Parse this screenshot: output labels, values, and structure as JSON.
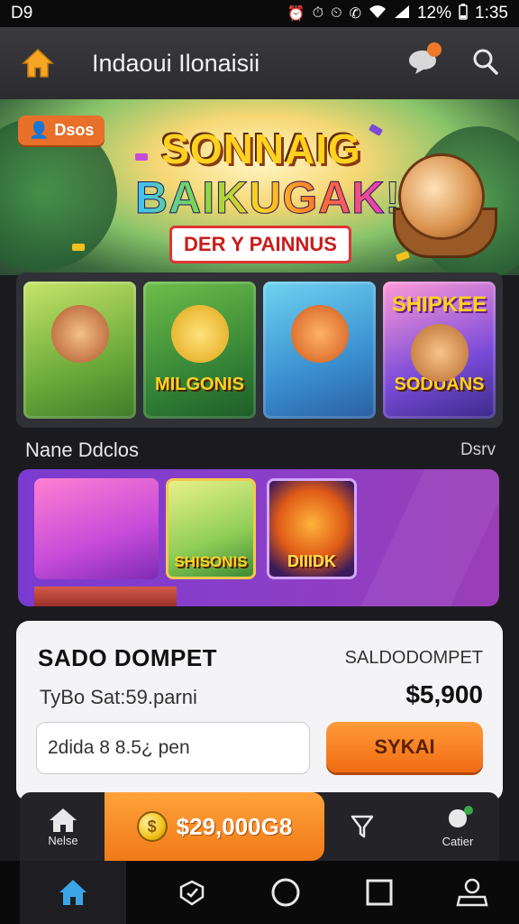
{
  "status_bar": {
    "left": "D9",
    "battery": "12%",
    "time": "1:35"
  },
  "app_bar": {
    "title": "Indaoui Ilonaisii"
  },
  "banner": {
    "users_badge": "Dsos",
    "title_line1": "SONNAIG",
    "title_line2": "BAIKUGAK!",
    "ribbon": "DER Y PAINNUS"
  },
  "game_grid": {
    "tiles": [
      {
        "label": ""
      },
      {
        "label": "MILGONIS"
      },
      {
        "label": ""
      },
      {
        "label_top": "SHIPKEE",
        "label": "SODUANS"
      }
    ]
  },
  "section": {
    "title": "Nane Ddclos",
    "more": "Dsrv"
  },
  "promo": {
    "tiles": [
      {
        "label": ""
      },
      {
        "label": "SHISONIS"
      },
      {
        "label": "DIIIDK"
      }
    ]
  },
  "wallet": {
    "title": "SADO DOMPET",
    "title_right": "SALDODOMPET",
    "subtitle": "TyBo Sat:59.parni",
    "amount": "$5,900",
    "input_value": "2dida 8 8.5¿ pen",
    "button_label": "SYKAI"
  },
  "bottom_bar": {
    "home_label": "Nelse",
    "balance": "$29,000G8",
    "account_label": "Catier"
  },
  "colors": {
    "accent": "#f07a18",
    "promo": "#8a3fc8",
    "wallet_bg": "#f4f4f6"
  }
}
